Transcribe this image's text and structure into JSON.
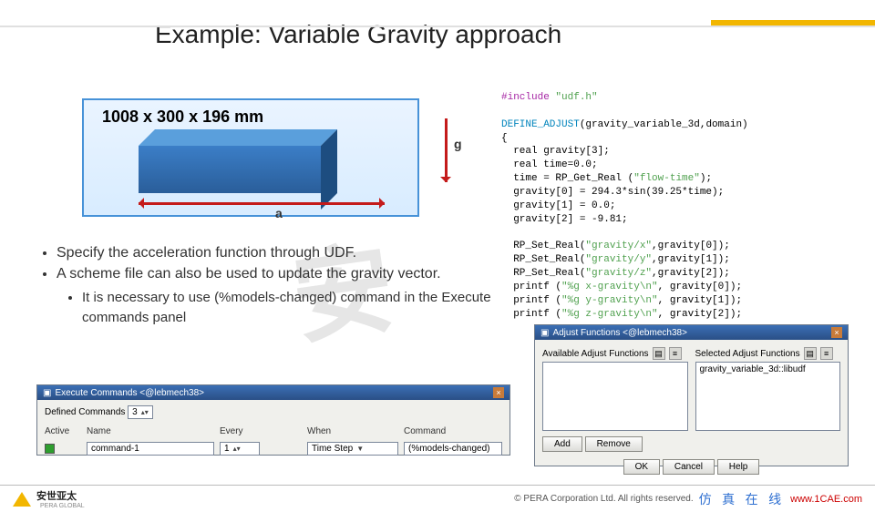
{
  "title": "Example: Variable Gravity approach",
  "box": {
    "dimensions": "1008 x 300 x 196 mm",
    "g": "g",
    "a": "a"
  },
  "bullets": {
    "b1": "Specify the acceleration function through UDF.",
    "b2": "A scheme file can also be used to update the gravity vector.",
    "b2a": "It is necessary to use (%models-changed) command in the Execute commands panel"
  },
  "code": {
    "l1a": "#include ",
    "l1b": "\"udf.h\"",
    "l2a": "DEFINE_ADJUST",
    "l2b": "(gravity_variable_3d,domain)",
    "l3": "{",
    "l4": "  real gravity[3];",
    "l5": "  real time=0.0;",
    "l6a": "  time = RP_Get_Real (",
    "l6b": "\"flow-time\"",
    "l6c": ");",
    "l7": "  gravity[0] = 294.3*sin(39.25*time);",
    "l8": "  gravity[1] = 0.0;",
    "l9": "  gravity[2] = -9.81;",
    "blank": " ",
    "l10a": "  RP_Set_Real(",
    "l10b": "\"gravity/x\"",
    "l10c": ",gravity[0]);",
    "l11a": "  RP_Set_Real(",
    "l11b": "\"gravity/y\"",
    "l11c": ",gravity[1]);",
    "l12a": "  RP_Set_Real(",
    "l12b": "\"gravity/z\"",
    "l12c": ",gravity[2]);",
    "l13a": "  printf (",
    "l13b": "\"%g x-gravity\\n\"",
    "l13c": ", gravity[0]);",
    "l14a": "  printf (",
    "l14b": "\"%g y-gravity\\n\"",
    "l14c": ", gravity[1]);",
    "l15a": "  printf (",
    "l15b": "\"%g z-gravity\\n\"",
    "l15c": ", gravity[2]);"
  },
  "exec": {
    "title": "Execute Commands <@lebmech38>",
    "defined_label": "Defined Commands",
    "defined_value": "3",
    "col_active": "Active",
    "col_name": "Name",
    "col_every": "Every",
    "col_when": "When",
    "col_command": "Command",
    "name": "command-1",
    "every": "1",
    "when": "Time Step",
    "command": "(%models-changed)"
  },
  "adjust": {
    "title": "Adjust Functions <@lebmech38>",
    "avail": "Available Adjust Functions",
    "sel": "Selected Adjust Functions",
    "item": "gravity_variable_3d::libudf",
    "add": "Add",
    "remove": "Remove",
    "ok": "OK",
    "cancel": "Cancel",
    "help": "Help"
  },
  "footer": {
    "brand_cn": "安世亚太",
    "brand_en": "PERA GLOBAL",
    "copyright": "©   PERA Corporation Ltd. All rights reserved.",
    "zh": "仿 真 在 线",
    "url": "www.1CAE.com"
  },
  "watermark": "安"
}
